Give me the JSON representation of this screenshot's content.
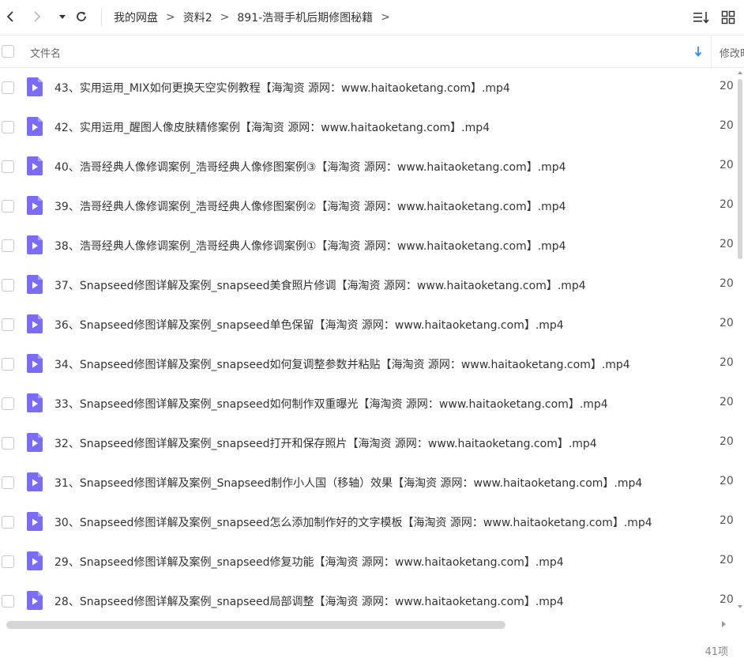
{
  "toolbar": {
    "breadcrumbs": [
      "我的网盘",
      "资料2",
      "891-浩哥手机后期修图秘籍"
    ],
    "crumb_separator": ">"
  },
  "header": {
    "name_label": "文件名",
    "modified_label": "修改时间"
  },
  "files": [
    {
      "name": "43、实用运用_MIX如何更换天空实例教程【海淘资 源网：www.haitaoketang.com】.mp4",
      "date": "20"
    },
    {
      "name": "42、实用运用_醒图人像皮肤精修案例【海淘资 源网：www.haitaoketang.com】.mp4",
      "date": "20"
    },
    {
      "name": "40、浩哥经典人像修调案例_浩哥经典人像修图案例③【海淘资 源网：www.haitaoketang.com】.mp4",
      "date": "20"
    },
    {
      "name": "39、浩哥经典人像修调案例_浩哥经典人像修图案例②【海淘资 源网：www.haitaoketang.com】.mp4",
      "date": "20"
    },
    {
      "name": "38、浩哥经典人像修调案例_浩哥经典人像修调案例①【海淘资 源网：www.haitaoketang.com】.mp4",
      "date": "20"
    },
    {
      "name": "37、Snapseed修图详解及案例_snapseed美食照片修调【海淘资 源网：www.haitaoketang.com】.mp4",
      "date": "20"
    },
    {
      "name": "36、Snapseed修图详解及案例_snapseed单色保留【海淘资 源网：www.haitaoketang.com】.mp4",
      "date": "20"
    },
    {
      "name": "34、Snapseed修图详解及案例_snapseed如何复调整参数并粘贴【海淘资 源网：www.haitaoketang.com】.mp4",
      "date": "20"
    },
    {
      "name": "33、Snapseed修图详解及案例_snapseed如何制作双重曝光【海淘资 源网：www.haitaoketang.com】.mp4",
      "date": "20"
    },
    {
      "name": "32、Snapseed修图详解及案例_snapseed打开和保存照片【海淘资 源网：www.haitaoketang.com】.mp4",
      "date": "20"
    },
    {
      "name": "31、Snapseed修图详解及案例_Snapseed制作小人国（移轴）效果【海淘资 源网：www.haitaoketang.com】.mp4",
      "date": "20"
    },
    {
      "name": "30、Snapseed修图详解及案例_snapseed怎么添加制作好的文字模板【海淘资 源网：www.haitaoketang.com】.mp4",
      "date": "20"
    },
    {
      "name": "29、Snapseed修图详解及案例_snapseed修复功能【海淘资 源网：www.haitaoketang.com】.mp4",
      "date": "20"
    },
    {
      "name": "28、Snapseed修图详解及案例_snapseed局部调整【海淘资 源网：www.haitaoketang.com】.mp4",
      "date": "20"
    }
  ],
  "footer": {
    "item_count": "41项"
  },
  "icons": {
    "back": "chevron-left-icon",
    "forward": "chevron-right-icon",
    "history": "caret-down-icon",
    "refresh": "refresh-icon",
    "sort": "sort-list-icon",
    "view": "grid-view-icon",
    "file": "video-file-icon"
  },
  "colors": {
    "file_icon": "#7b6cf6",
    "sort_arrow": "#2d8cf0",
    "scrollbar": "#d6d6d6"
  }
}
